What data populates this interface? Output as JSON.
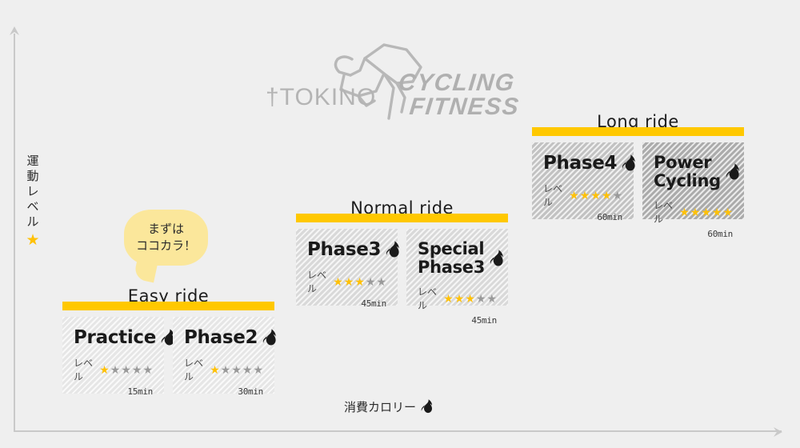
{
  "page": {
    "background_color": "#efefef",
    "accent_yellow": "#FFC800",
    "star_on_color": "#FFC107",
    "star_off_color": "#9a9a9a"
  },
  "logo": {
    "brand": "†TOKINO",
    "line1": "CYCLING",
    "line2": "FITNESS",
    "cyclist_icon": "cyclist-icon",
    "color": "#b0b0b0"
  },
  "axes": {
    "y_label_chars": [
      "運",
      "動",
      "レ",
      "ベ",
      "ル"
    ],
    "y_label_star": "★",
    "x_label": "消費カロリー",
    "x_label_icon": "flame-icon",
    "line_color": "#c9c9c9"
  },
  "callout": {
    "text": "まずは\nココカラ！",
    "background_color": "#FBE79B"
  },
  "groups": [
    {
      "id": "easy-ride",
      "title": "Easy ride",
      "shade": "",
      "cards": [
        {
          "title": "Practice",
          "flame_icon": "flame-icon",
          "level_label": "レベル",
          "stars_filled": 1,
          "stars_total": 5,
          "duration": "15min"
        },
        {
          "title": "Phase2",
          "flame_icon": "flame-icon",
          "level_label": "レベル",
          "stars_filled": 1,
          "stars_total": 5,
          "duration": "30min"
        }
      ]
    },
    {
      "id": "normal-ride",
      "title": "Normal ride",
      "shade": "shade-mid",
      "cards": [
        {
          "title": "Phase3",
          "flame_icon": "flame-icon",
          "level_label": "レベル",
          "stars_filled": 3,
          "stars_total": 5,
          "duration": "45min"
        },
        {
          "title": "Special\nPhase3",
          "flame_icon": "flame-icon",
          "level_label": "レベル",
          "stars_filled": 3,
          "stars_total": 5,
          "duration": "45min"
        }
      ]
    },
    {
      "id": "long-ride",
      "title": "Long ride",
      "shade": "shade-dark",
      "cards": [
        {
          "title": "Phase4",
          "flame_icon": "flame-icon",
          "level_label": "レベル",
          "stars_filled": 4,
          "stars_total": 5,
          "duration": "60min",
          "shade": "shade-dark"
        },
        {
          "title": "Power\nCycling",
          "flame_icon": "flame-icon",
          "level_label": "レベル",
          "stars_filled": 5,
          "stars_total": 5,
          "duration": "60min",
          "shade": "shade-darker"
        }
      ]
    }
  ]
}
